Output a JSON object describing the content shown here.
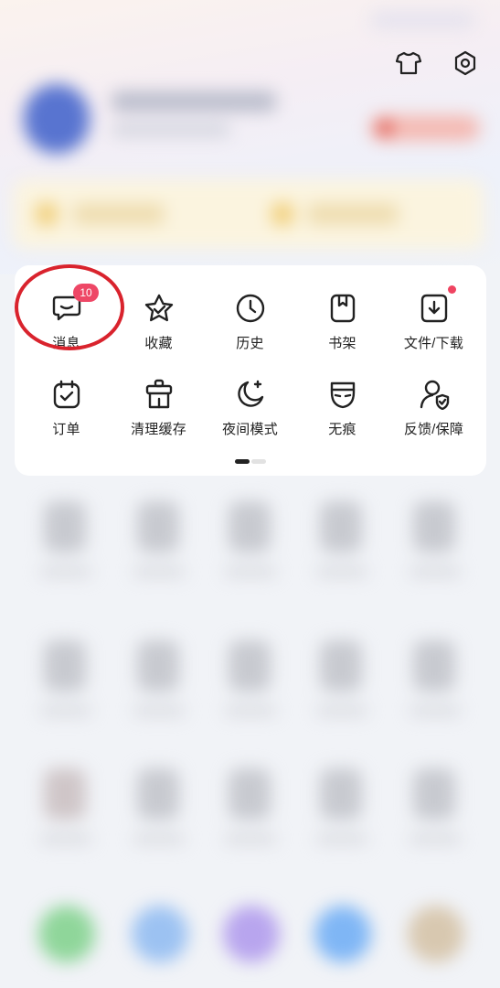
{
  "header": {
    "icons": [
      {
        "name": "theme-shirt-icon"
      },
      {
        "name": "settings-gear-icon"
      }
    ]
  },
  "menu": {
    "row1": [
      {
        "label": "消息",
        "icon": "message-icon",
        "badge": "10"
      },
      {
        "label": "收藏",
        "icon": "star-icon"
      },
      {
        "label": "历史",
        "icon": "clock-icon"
      },
      {
        "label": "书架",
        "icon": "bookshelf-icon"
      },
      {
        "label": "文件/下载",
        "icon": "download-icon",
        "dot": true
      }
    ],
    "row2": [
      {
        "label": "订单",
        "icon": "order-calendar-icon"
      },
      {
        "label": "清理缓存",
        "icon": "clean-cache-icon"
      },
      {
        "label": "夜间模式",
        "icon": "night-mode-moon-icon"
      },
      {
        "label": "无痕",
        "icon": "incognito-mask-icon"
      },
      {
        "label": "反馈/保障",
        "icon": "feedback-shield-icon"
      }
    ],
    "pager": {
      "current": 1,
      "total": 2
    }
  },
  "colors": {
    "badge": "#ee4766",
    "highlight_ring": "#d9232d",
    "card_bg": "#ffffff",
    "page_bg": "#f1f3f7"
  }
}
